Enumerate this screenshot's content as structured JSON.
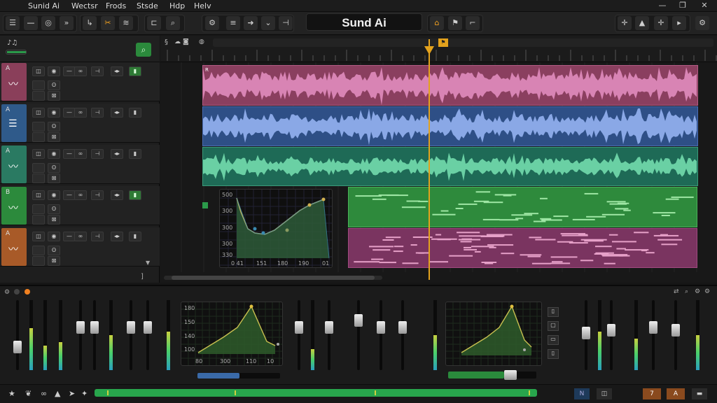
{
  "menubar": {
    "items": [
      "Sunid Ai",
      "Wectsr",
      "Frods",
      "Stsde",
      "Hdp",
      "Helv"
    ]
  },
  "app_title": "Sund Ai",
  "tracks": [
    {
      "num": "A",
      "color": "#8a3f5a"
    },
    {
      "num": "A",
      "color": "#2f5a8a"
    },
    {
      "num": "A",
      "color": "#2a7a62"
    },
    {
      "num": "B",
      "color": "#2c8a3c"
    },
    {
      "num": "A",
      "color": "#a85a28"
    }
  ],
  "eq_popup": {
    "y_labels": [
      "500",
      "300",
      "300",
      "300",
      "330"
    ],
    "x_labels": [
      "0 41",
      "151",
      "180",
      "190",
      "01"
    ]
  },
  "mixer_eq_left": {
    "y_labels": [
      "180",
      "150",
      "140",
      "100"
    ],
    "x_labels": [
      "80",
      "300",
      "110",
      "10"
    ]
  },
  "colors": {
    "accent": "#e3a21d",
    "track_pink": "#b45a86",
    "track_blue": "#5a78c8",
    "track_green": "#3aa07a",
    "midi_green": "#3aa44a",
    "midi_pink": "#a04a80"
  }
}
